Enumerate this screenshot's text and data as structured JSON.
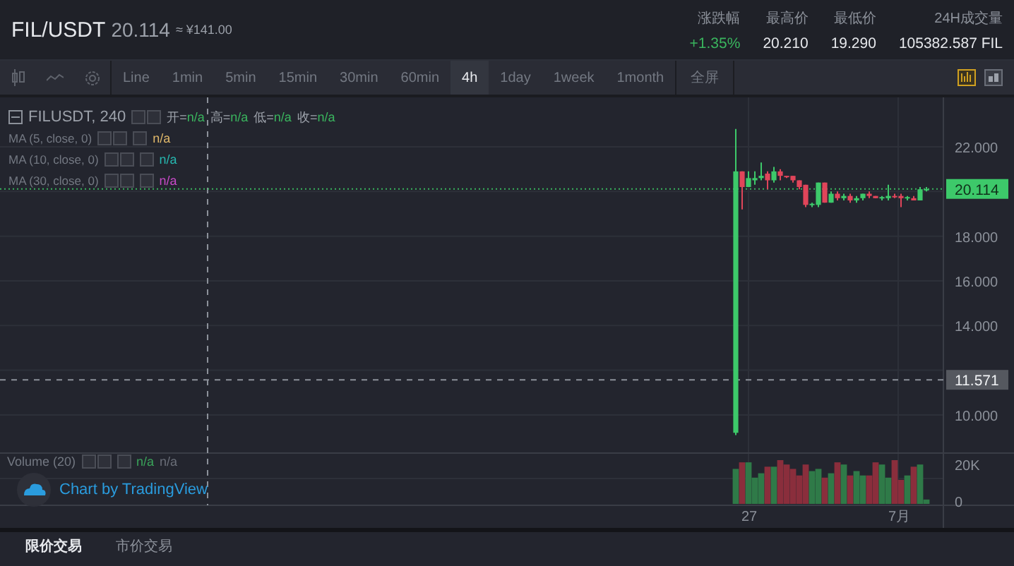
{
  "header": {
    "pair": "FIL/USDT",
    "price": "20.114",
    "approx": "≈ ¥141.00",
    "stats": [
      {
        "label": "涨跌幅",
        "value": "+1.35%",
        "kind": "up"
      },
      {
        "label": "最高价",
        "value": "20.210",
        "kind": "plain"
      },
      {
        "label": "最低价",
        "value": "19.290",
        "kind": "plain"
      },
      {
        "label": "24H成交量",
        "value": "105382.587 FIL",
        "kind": "plain"
      }
    ]
  },
  "toolbar": {
    "intervals": [
      {
        "label": "Line",
        "selected": false
      },
      {
        "label": "1min",
        "selected": false
      },
      {
        "label": "5min",
        "selected": false
      },
      {
        "label": "15min",
        "selected": false
      },
      {
        "label": "30min",
        "selected": false
      },
      {
        "label": "60min",
        "selected": false
      },
      {
        "label": "4h",
        "selected": true
      },
      {
        "label": "1day",
        "selected": false
      },
      {
        "label": "1week",
        "selected": false
      },
      {
        "label": "1month",
        "selected": false
      }
    ],
    "fullscreen": "全屏"
  },
  "legend": {
    "title": "FILUSDT, 240",
    "ohlc": [
      {
        "label": "开=",
        "value": "n/a"
      },
      {
        "label": "高=",
        "value": "n/a"
      },
      {
        "label": "低=",
        "value": "n/a"
      },
      {
        "label": "收=",
        "value": "n/a"
      }
    ],
    "ma": [
      {
        "label": "MA (5, close, 0)",
        "value": "n/a",
        "color": "#e0b86a"
      },
      {
        "label": "MA (10, close, 0)",
        "value": "n/a",
        "color": "#26b8b0"
      },
      {
        "label": "MA (30, close, 0)",
        "value": "n/a",
        "color": "#c84ac8"
      }
    ],
    "volume": {
      "label": "Volume (20)",
      "values": [
        {
          "value": "n/a",
          "color": "#3aa35a"
        },
        {
          "value": "n/a",
          "color": "#6a6e78"
        }
      ]
    }
  },
  "attribution": "Chart by TradingView",
  "y_axis": {
    "ticks": [
      "22.000",
      "18.000",
      "16.000",
      "14.000",
      "10.000"
    ],
    "volume_ticks": [
      "20K",
      "0"
    ]
  },
  "x_axis": {
    "ticks": [
      "27",
      "7月"
    ]
  },
  "last_price_label": "20.114",
  "crosshair_label": "11.571",
  "order_tabs": [
    {
      "label": "限价交易",
      "selected": true
    },
    {
      "label": "市价交易",
      "selected": false
    }
  ]
}
